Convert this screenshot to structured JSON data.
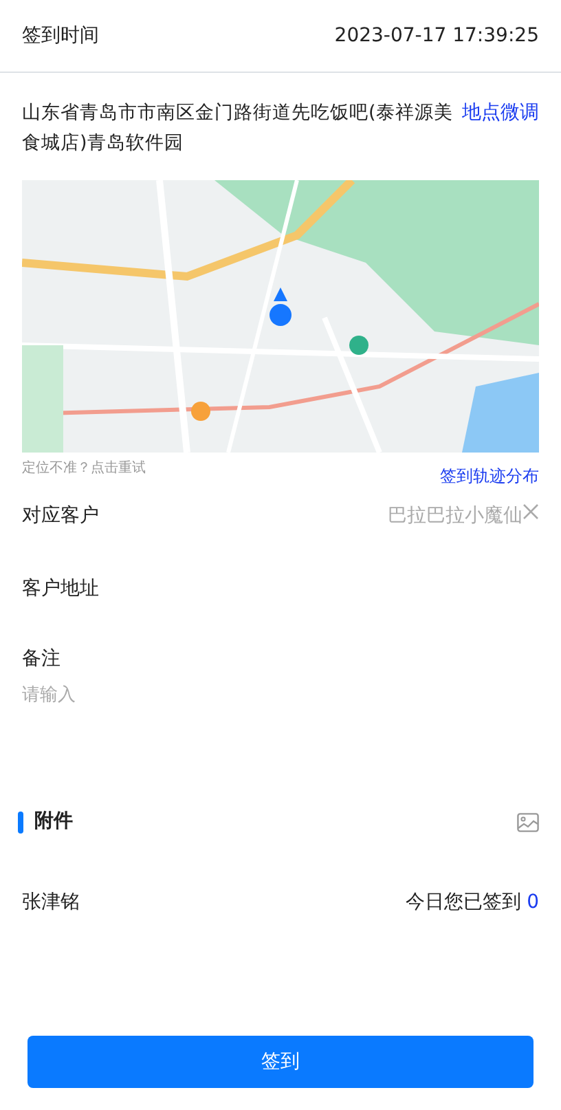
{
  "checkin_time": {
    "label": "签到时间",
    "value": "2023-07-17 17:39:25"
  },
  "address": {
    "text": "山东省青岛市市南区金门路街道先吃饭吧(泰祥源美食城店)青岛软件园",
    "adjust_link": "地点微调"
  },
  "relocate_hint": "定位不准？点击重试",
  "track_link": "签到轨迹分布",
  "customer": {
    "label": "对应客户",
    "value": "巴拉巴拉小魔仙"
  },
  "customer_address": {
    "label": "客户地址"
  },
  "remark": {
    "label": "备注",
    "placeholder": "请输入"
  },
  "attachment": {
    "title": "附件"
  },
  "footer": {
    "user": "张津铭",
    "count_label": "今日您已签到",
    "count": "0"
  },
  "submit_button": "签到"
}
